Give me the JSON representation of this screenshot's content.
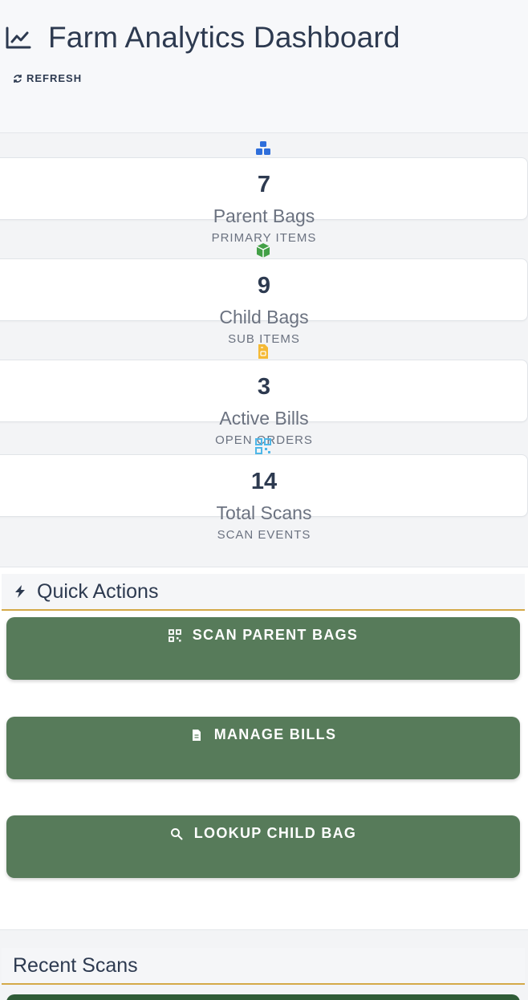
{
  "header": {
    "title": "Farm Analytics Dashboard",
    "refresh_label": "REFRESH",
    "title_icon": "chart-line-icon",
    "refresh_icon": "refresh-icon"
  },
  "stats": [
    {
      "value": "7",
      "label": "Parent Bags",
      "sub": "PRIMARY ITEMS",
      "icon": "boxes-icon",
      "icon_color": "#2f6fdb"
    },
    {
      "value": "9",
      "label": "Child Bags",
      "sub": "SUB ITEMS",
      "icon": "cube-icon",
      "icon_color": "#43a047"
    },
    {
      "value": "3",
      "label": "Active Bills",
      "sub": "OPEN ORDERS",
      "icon": "file-invoice-icon",
      "icon_color": "#f5b935"
    },
    {
      "value": "14",
      "label": "Total Scans",
      "sub": "SCAN EVENTS",
      "icon": "qrcode-icon",
      "icon_color": "#4fb7e8"
    }
  ],
  "quick_actions": {
    "title": "Quick Actions",
    "icon": "bolt-icon",
    "buttons": [
      {
        "label": "SCAN PARENT BAGS",
        "icon": "qrcode-icon"
      },
      {
        "label": "MANAGE BILLS",
        "icon": "file-icon"
      },
      {
        "label": "LOOKUP CHILD BAG",
        "icon": "search-icon"
      }
    ]
  },
  "recent_scans": {
    "title": "Recent Scans"
  },
  "colors": {
    "accent": "#d4a948",
    "button_green": "#577b5a",
    "text_dark": "#2d3a50",
    "text_muted": "#6b7280"
  }
}
